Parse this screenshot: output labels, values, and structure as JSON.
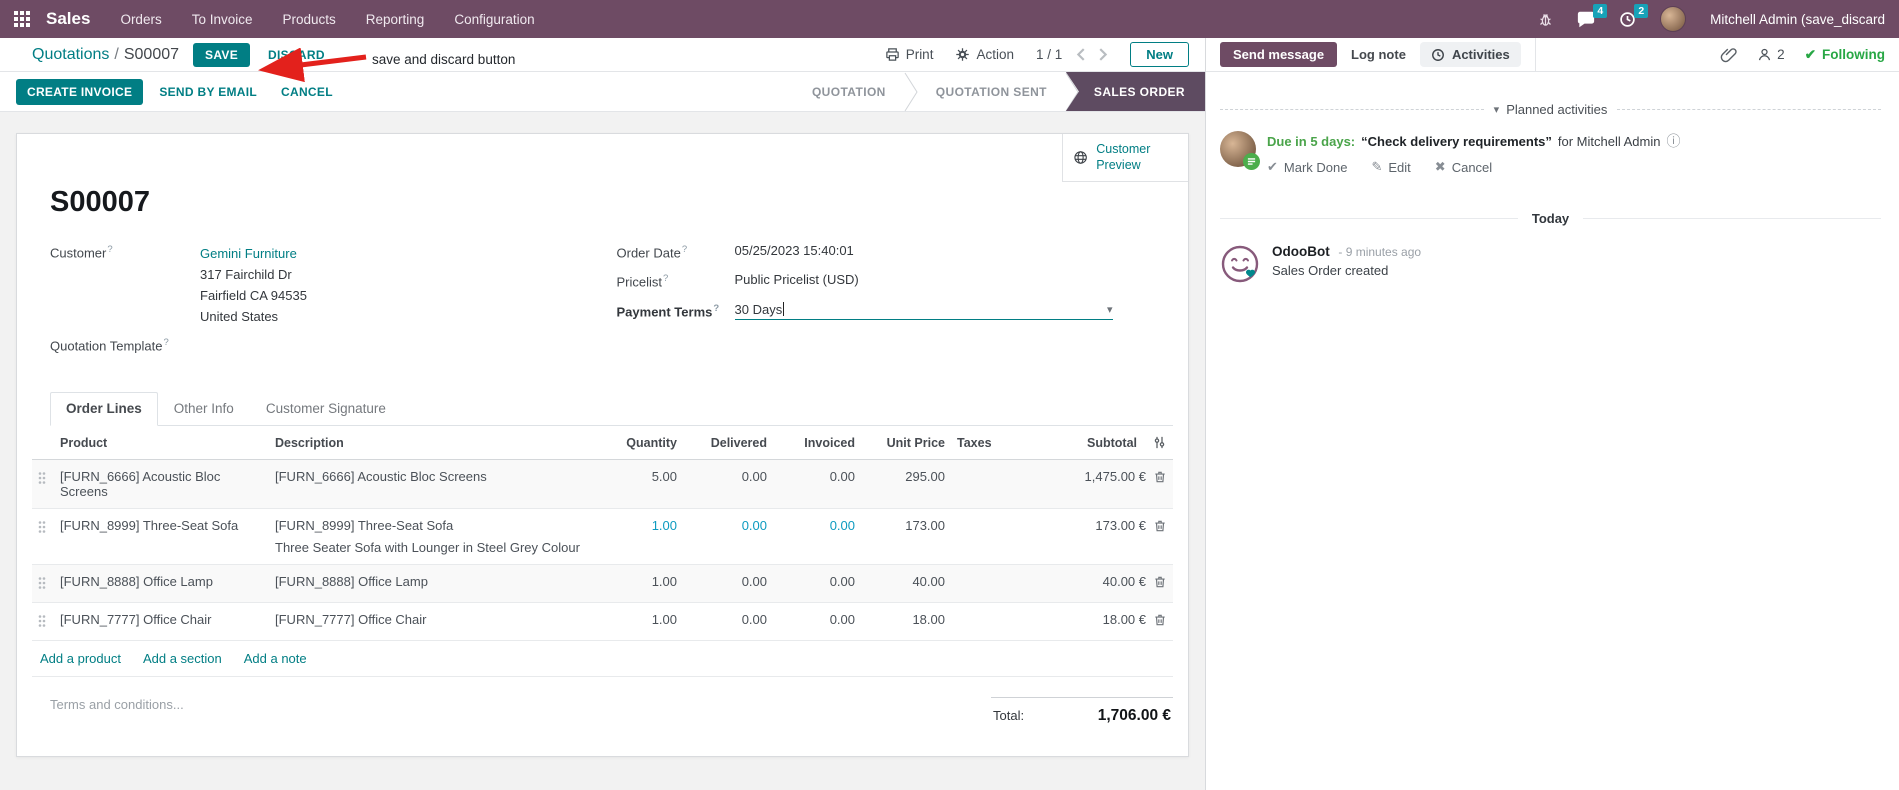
{
  "colors": {
    "topbar": "#6e4b64",
    "accent": "#017e84",
    "status-active": "#5e4b61",
    "badge": "#17a2b8",
    "annotation": "#e3211c",
    "green": "#28a745",
    "highlight": "#0e9bc0"
  },
  "glyphs": {
    "caret_down": "▾",
    "check": "✔",
    "pencil": "✎",
    "cross": "✖",
    "info": "ⓘ"
  },
  "topbar": {
    "app_name": "Sales",
    "menus": [
      "Orders",
      "To Invoice",
      "Products",
      "Reporting",
      "Configuration"
    ],
    "messages_badge": "4",
    "activities_badge": "2",
    "user_name": "Mitchell Admin (save_discard"
  },
  "control": {
    "breadcrumb_parent": "Quotations",
    "breadcrumb_sep": "/",
    "breadcrumb_current": "S00007",
    "save": "SAVE",
    "discard": "DISCARD",
    "print": "Print",
    "action": "Action",
    "pager": "1 / 1",
    "new": "New"
  },
  "annotation": {
    "text": "save and discard button"
  },
  "actions": {
    "create_invoice": "CREATE INVOICE",
    "send_by_email": "SEND BY EMAIL",
    "cancel": "CANCEL"
  },
  "statusbar": {
    "stages": [
      "QUOTATION",
      "QUOTATION SENT",
      "SALES ORDER"
    ],
    "active_stage": "SALES ORDER"
  },
  "sheet": {
    "customer_preview": "Customer Preview",
    "title": "S00007",
    "customer_label": "Customer",
    "customer_name": "Gemini Furniture",
    "address_line1": "317 Fairchild Dr",
    "address_line2": "Fairfield CA 94535",
    "address_line3": "United States",
    "quotation_template_label": "Quotation Template",
    "order_date_label": "Order Date",
    "order_date_value": "05/25/2023 15:40:01",
    "pricelist_label": "Pricelist",
    "pricelist_value": "Public Pricelist (USD)",
    "payment_terms_label": "Payment Terms",
    "payment_terms_value": "30 Days",
    "tabs": [
      "Order Lines",
      "Other Info",
      "Customer Signature"
    ],
    "order_lines": {
      "columns": [
        "Product",
        "Description",
        "Quantity",
        "Delivered",
        "Invoiced",
        "Unit Price",
        "Taxes",
        "Subtotal"
      ],
      "rows": [
        {
          "product": "[FURN_6666] Acoustic Bloc Screens",
          "description": "[FURN_6666] Acoustic Bloc Screens",
          "description2": "",
          "quantity": "5.00",
          "delivered": "0.00",
          "invoiced": "0.00",
          "unit_price": "295.00",
          "taxes": "",
          "subtotal": "1,475.00 €",
          "highlight": false
        },
        {
          "product": "[FURN_8999] Three-Seat Sofa",
          "description": "[FURN_8999] Three-Seat Sofa",
          "description2": "Three Seater Sofa with Lounger in Steel Grey Colour",
          "quantity": "1.00",
          "delivered": "0.00",
          "invoiced": "0.00",
          "unit_price": "173.00",
          "taxes": "",
          "subtotal": "173.00 €",
          "highlight": true
        },
        {
          "product": "[FURN_8888] Office Lamp",
          "description": "[FURN_8888] Office Lamp",
          "description2": "",
          "quantity": "1.00",
          "delivered": "0.00",
          "invoiced": "0.00",
          "unit_price": "40.00",
          "taxes": "",
          "subtotal": "40.00 €",
          "highlight": false
        },
        {
          "product": "[FURN_7777] Office Chair",
          "description": "[FURN_7777] Office Chair",
          "description2": "",
          "quantity": "1.00",
          "delivered": "0.00",
          "invoiced": "0.00",
          "unit_price": "18.00",
          "taxes": "",
          "subtotal": "18.00 €",
          "highlight": false
        }
      ],
      "links": [
        "Add a product",
        "Add a section",
        "Add a note"
      ]
    },
    "terms_placeholder": "Terms and conditions...",
    "total_label": "Total:",
    "total_value": "1,706.00 €"
  },
  "chatter": {
    "send_message": "Send message",
    "log_note": "Log note",
    "activities": "Activities",
    "followers_count": "2",
    "following": "Following",
    "planned_header": "Planned activities",
    "activity": {
      "due": "Due in 5 days:",
      "title": "“Check delivery requirements”",
      "assignee": "for Mitchell Admin",
      "mark_done": "Mark Done",
      "edit": "Edit",
      "cancel": "Cancel"
    },
    "today_label": "Today",
    "message": {
      "author": "OdooBot",
      "timestamp": "- 9 minutes ago",
      "body": "Sales Order created"
    }
  }
}
